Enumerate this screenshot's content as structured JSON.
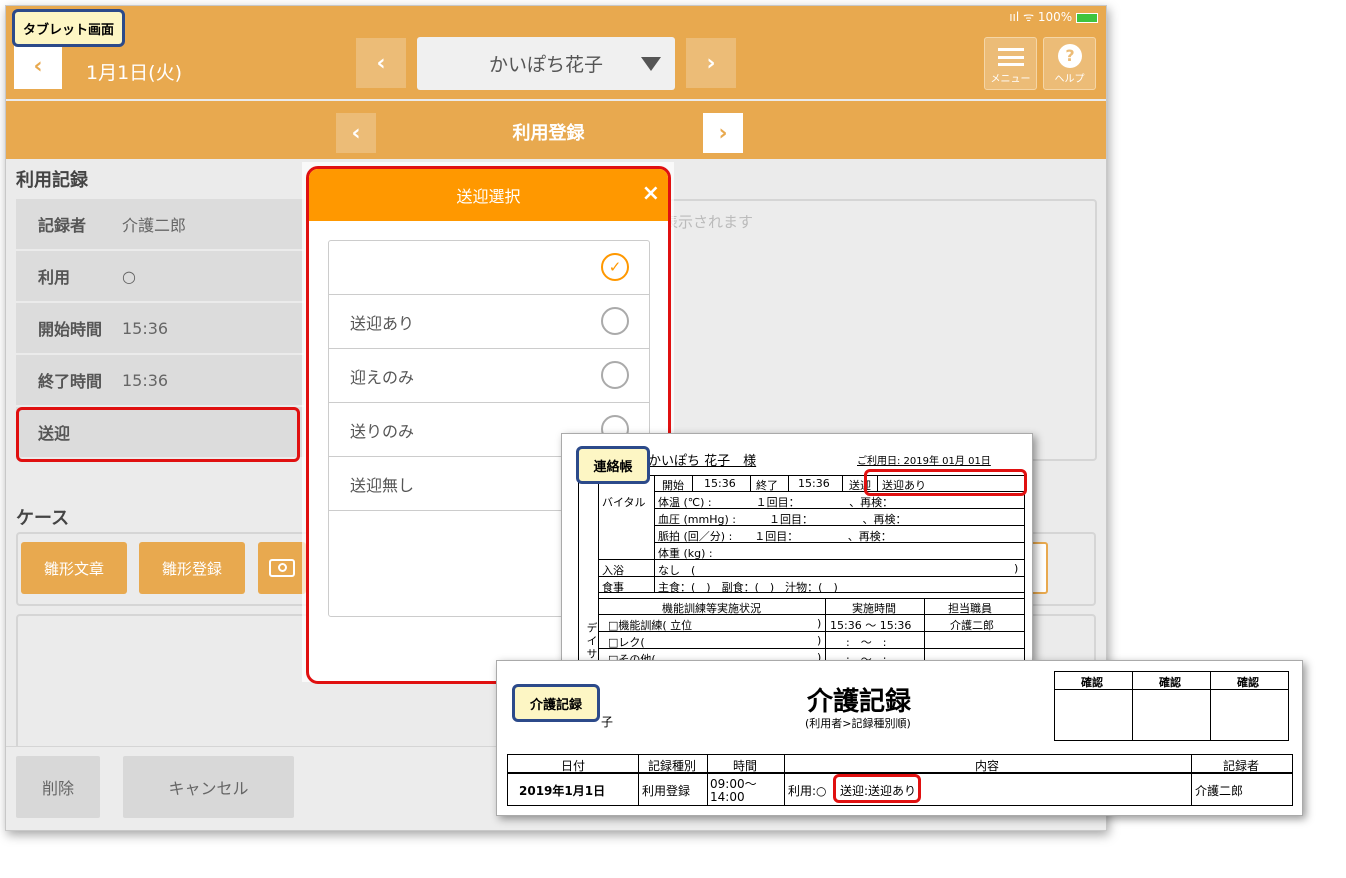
{
  "labels": {
    "tablet": "タブレット画面",
    "renraku": "連絡帳",
    "kaigo": "介護記録"
  },
  "status": {
    "signal": "ııl",
    "wifi": "ᯤ",
    "battery": "100%"
  },
  "header": {
    "date": "1月1日(火)",
    "user": "かいぽち花子",
    "menu_label": "メニュー",
    "help_label": "ヘルプ",
    "screen_title": "利用登録",
    "prev": "‹",
    "next": "›"
  },
  "record": {
    "section_title": "利用記録",
    "rows": [
      {
        "label": "記録者",
        "value": "介護二郎"
      },
      {
        "label": "利用",
        "value": "○"
      },
      {
        "label": "開始時間",
        "value": "15:36"
      },
      {
        "label": "終了時間",
        "value": "15:36"
      },
      {
        "label": "送迎",
        "value": ""
      }
    ],
    "memo_placeholder_tail": "表示されます"
  },
  "case": {
    "section_title": "ケース",
    "btn_template_text": "雛形文章",
    "btn_template_reg": "雛形登録",
    "camera_icon": "camera-icon"
  },
  "footer": {
    "delete": "削除",
    "cancel": "キャンセル"
  },
  "modal": {
    "title": "送迎選択",
    "close": "×",
    "options": [
      {
        "label": "",
        "selected": true
      },
      {
        "label": "送迎あり",
        "selected": false
      },
      {
        "label": "迎えのみ",
        "selected": false
      },
      {
        "label": "送りのみ",
        "selected": false
      },
      {
        "label": "送迎無し",
        "selected": false
      }
    ]
  },
  "renraku": {
    "name": "かいぽち 花子　様",
    "use_date": "ご利用日: 2019年 01月 01日",
    "row1": {
      "start_label": "開始",
      "start": "15:36",
      "end_label": "終了",
      "end": "15:36",
      "sougei_label": "送迎",
      "sougei": "送迎あり"
    },
    "vital_label": "バイタル",
    "vitals": [
      "体温 (℃) :　　　　１回目：　　　　　、再検：",
      "血圧 (mmHg) :　　　１回目：　　　　　、再検：",
      "脈拍 (回／分) :　　１回目：　　　　　、再検：",
      "体重 (kg) :"
    ],
    "bath_label": "入浴",
    "bath": "なし　(",
    "bath_close": ")",
    "meal_label": "食事",
    "meal": "主食：(　)　副食：(　)　汁物：(　)",
    "train_head": "機能訓練等実施状況",
    "time_head": "実施時間",
    "staff_head": "担当職員",
    "train_rows": [
      {
        "item": "□機能訓練( 立位",
        "time": "15:36 ～ 15:36",
        "staff": "介護二郎"
      },
      {
        "item": "□レク(",
        "time": ":　～　:",
        "staff": ""
      },
      {
        "item": "□その他(",
        "time": ":　～　:",
        "staff": ""
      }
    ],
    "side": "デイサ"
  },
  "kaigo": {
    "title": "介護記録",
    "subtitle": "(利用者>記録種別順)",
    "user_tail": "子",
    "confirm": [
      "確認",
      "確認",
      "確認"
    ],
    "headers": [
      "日付",
      "記録種別",
      "時間",
      "内容",
      "記録者"
    ],
    "row": {
      "date": "2019年1月1日",
      "type": "利用登録",
      "time1": "09:00～",
      "time2": "14:00",
      "content1": "利用:○",
      "content2": "送迎:送迎あり",
      "staff": "介護二郎"
    }
  },
  "colors": {
    "orange": "#e8a94f",
    "modal_orange": "#ff9800",
    "red": "#e01010",
    "badge_border": "#2c4a8a"
  }
}
